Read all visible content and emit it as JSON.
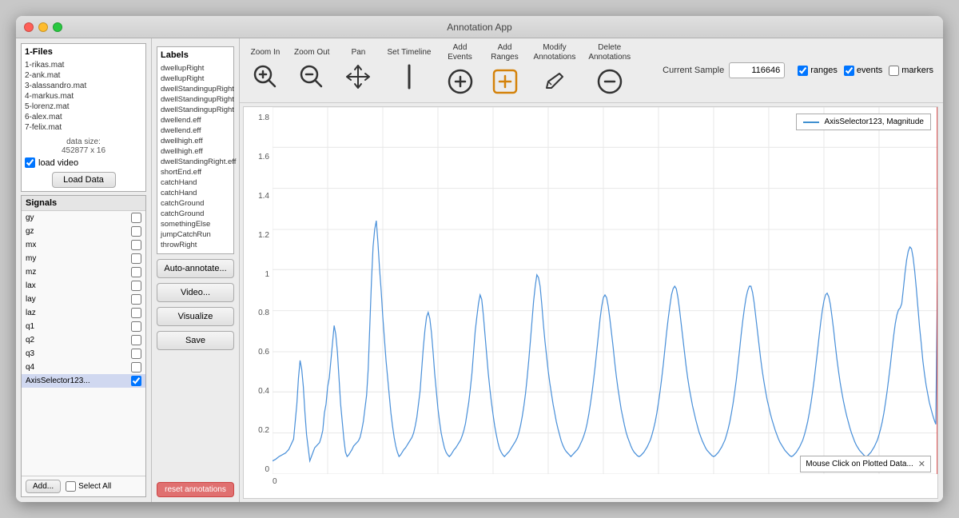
{
  "window": {
    "title": "Annotation App"
  },
  "files_panel": {
    "title": "1-Files",
    "files": [
      {
        "name": "1-rikas.mat",
        "selected": false
      },
      {
        "name": "2-ank.mat",
        "selected": false
      },
      {
        "name": "3-alassandro.mat",
        "selected": false
      },
      {
        "name": "4-markus.mat",
        "selected": false
      },
      {
        "name": "5-lorenz.mat",
        "selected": false
      },
      {
        "name": "6-alex.mat",
        "selected": false
      },
      {
        "name": "7-felix.mat",
        "selected": false
      }
    ],
    "data_size_label": "data size:",
    "data_size_value": "452877 x 16",
    "load_video_label": "load video",
    "load_data_button": "Load Data"
  },
  "labels_panel": {
    "title": "Labels",
    "labels": [
      "dwellupRight",
      "dwellupRight",
      "dwellStandingupRight",
      "dwellStandingupRight",
      "dwellStandingupRight",
      "dwellend.eff",
      "dwellend.eff",
      "dwellhigh.eff",
      "dwellhigh.eff",
      "dwellStandingRight.eff",
      "shortEnd.eff",
      "catchHand",
      "catchHand",
      "catchGround",
      "catchGround",
      "somethingElse",
      "jumpCatchRun",
      "throwRight"
    ]
  },
  "middle_buttons": {
    "auto_annotate": "Auto-annotate...",
    "video": "Video...",
    "visualize": "Visualize",
    "save": "Save",
    "reset_annotations": "reset annotations"
  },
  "toolbar": {
    "zoom_in_label": "Zoom In",
    "zoom_out_label": "Zoom Out",
    "pan_label": "Pan",
    "set_timeline_label": "Set Timeline",
    "add_events_label": "Add\nEvents",
    "add_ranges_label": "Add\nRanges",
    "modify_annotations_label": "Modify\nAnnotations",
    "delete_annotations_label": "Delete\nAnnotations",
    "current_sample_label": "Current Sample",
    "current_sample_value": "116646",
    "ranges_label": "ranges",
    "events_label": "events",
    "markers_label": "markers"
  },
  "signals": {
    "title": "Signals",
    "items": [
      {
        "name": "gy",
        "checked": false
      },
      {
        "name": "gz",
        "checked": false
      },
      {
        "name": "mx",
        "checked": false
      },
      {
        "name": "my",
        "checked": false
      },
      {
        "name": "mz",
        "checked": false
      },
      {
        "name": "lax",
        "checked": false
      },
      {
        "name": "lay",
        "checked": false
      },
      {
        "name": "laz",
        "checked": false
      },
      {
        "name": "q1",
        "checked": false
      },
      {
        "name": "q2",
        "checked": false
      },
      {
        "name": "q3",
        "checked": false
      },
      {
        "name": "q4",
        "checked": false
      },
      {
        "name": "AxisSelector123...",
        "checked": true
      }
    ],
    "add_button": "Add...",
    "select_all_label": "Select All"
  },
  "chart": {
    "legend_label": "AxisSelector123, Magnitude",
    "y_axis_values": [
      "1.8",
      "1.6",
      "1.4",
      "1.2",
      "1.0",
      "0.8",
      "0.6",
      "0.4",
      "0.2",
      "0"
    ],
    "x_axis_values": [
      "0",
      "",
      "",
      "",
      "",
      "",
      "",
      "",
      "",
      "",
      "",
      ""
    ],
    "status_text": "Mouse Click on Plotted Data..."
  }
}
